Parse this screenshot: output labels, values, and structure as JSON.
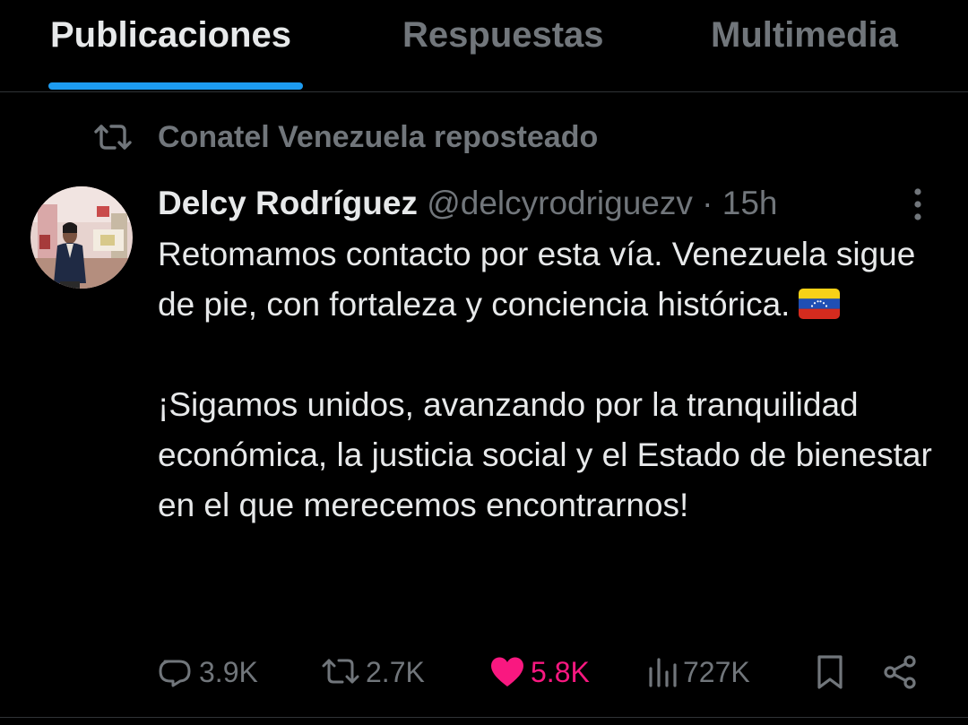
{
  "tabs": [
    {
      "label": "Publicaciones",
      "active": true
    },
    {
      "label": "Respuestas",
      "active": false
    },
    {
      "label": "Multimedia",
      "active": false
    }
  ],
  "colors": {
    "background": "#000000",
    "text_primary": "#e7e9ea",
    "text_secondary": "#71767b",
    "accent": "#1d9bf0",
    "like": "#f91880",
    "divider": "#2f3336"
  },
  "repost": {
    "icon": "repost-icon",
    "text": "Conatel Venezuela reposteado"
  },
  "post": {
    "author": {
      "name": "Delcy Rodríguez",
      "handle": "@delcyrodriguezv",
      "avatar_icon": "avatar-photo"
    },
    "separator": "·",
    "time": "15h",
    "more_icon": "more-icon",
    "paragraphs": [
      "Retomamos contacto por esta vía. Venezuela sigue de pie, con fortaleza y conciencia histórica.",
      "¡Sigamos unidos, avanzando por la tranquilidad económica, la justicia social y el Estado de bienestar en el que merecemos encontrarnos!"
    ],
    "emoji": "venezuela-flag-icon"
  },
  "actions": {
    "replies": {
      "icon": "reply-icon",
      "count": "3.9K"
    },
    "reposts": {
      "icon": "repost-icon",
      "count": "2.7K"
    },
    "likes": {
      "icon": "heart-icon",
      "count": "5.8K",
      "liked": true
    },
    "views": {
      "icon": "views-icon",
      "count": "727K"
    },
    "bookmark": {
      "icon": "bookmark-icon"
    },
    "share": {
      "icon": "share-icon"
    }
  }
}
